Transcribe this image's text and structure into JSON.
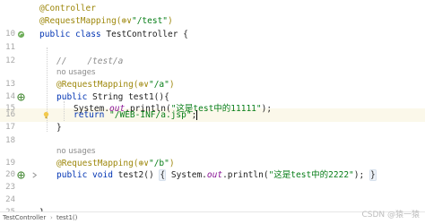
{
  "lines": {
    "l1": {
      "ann": "@Controller"
    },
    "l2": {
      "ann": "@RequestMapping(",
      "icon": "⊕∨",
      "str": "\"/test\"",
      "close": ")"
    },
    "l3": {
      "num": "10",
      "kw": "public class ",
      "rest": "TestController {"
    },
    "l4": {
      "num": "11"
    },
    "l5": {
      "num": "12",
      "comment": "//    /test/a"
    },
    "hint1": {
      "text": "no usages"
    },
    "l6": {
      "num": "13",
      "ann": "@RequestMapping(",
      "icon": "⊕∨",
      "str": "\"/a\"",
      "close": ")"
    },
    "l7": {
      "num": "14",
      "kw": "public ",
      "rest": "String test1(){"
    },
    "l8": {
      "num": "15",
      "pre": "System.",
      "fld": "out",
      "post": ".println(",
      "str": "\"这是test中的11111\"",
      "end": ");"
    },
    "l9": {
      "num": "16",
      "kw": "return ",
      "str": "\"/WEB-INF/a.jsp\"",
      "end": ";"
    },
    "l10": {
      "num": "17",
      "rest": "}"
    },
    "l11": {
      "num": "18"
    },
    "hint2": {
      "text": "no usages"
    },
    "l12": {
      "num": "19",
      "ann": "@RequestMapping(",
      "icon": "⊕∨",
      "str": "\"/b\"",
      "close": ")"
    },
    "l13": {
      "num": "20",
      "kw": "public void ",
      "m": "test2() ",
      "ob": "{",
      "pre": " System.",
      "fld": "out",
      "post": ".println(",
      "str": "\"这是test中的2222\"",
      "end": "); ",
      "cb": "}"
    },
    "l14": {
      "num": "23"
    },
    "l15": {
      "num": "24"
    },
    "l16": {
      "num": "25",
      "rest": "}"
    }
  },
  "breadcrumb": {
    "class": "TestController",
    "sep": "›",
    "method": "test1()"
  },
  "watermark": "CSDN @猿一猿",
  "colors": {
    "annotation": "#9e880d",
    "keyword": "#0033b3",
    "string": "#067d17",
    "field": "#871094",
    "current_line": "#fbf8ea"
  },
  "icons": {
    "bean": "spring-bean-icon",
    "request": "request-mapping-icon",
    "bulb": "intention-bulb-icon",
    "fold": "fold-arrow-icon"
  }
}
